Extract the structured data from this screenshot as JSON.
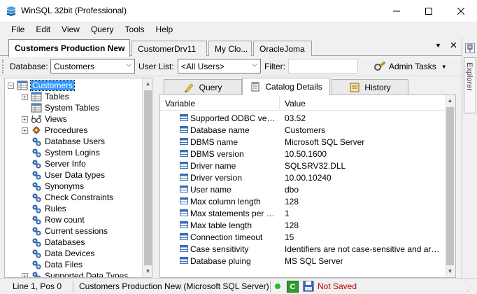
{
  "window": {
    "title": "WinSQL 32bit (Professional)",
    "minimize_icon": "minimize-icon",
    "maximize_icon": "maximize-icon",
    "close_icon": "close-icon"
  },
  "menu": [
    "File",
    "Edit",
    "View",
    "Query",
    "Tools",
    "Help"
  ],
  "tabs": [
    {
      "label": "Customers Production New",
      "active": true
    },
    {
      "label": "CustomerDrv11",
      "active": false
    },
    {
      "label": "My Clo...",
      "active": false
    },
    {
      "label": "OracleJoma",
      "active": false
    }
  ],
  "explorer": {
    "label": "Explorer"
  },
  "toolbar": {
    "database_label": "Database:",
    "database_value": "Customers",
    "user_list_label": "User List:",
    "user_list_value": "<All Users>",
    "filter_label": "Filter:",
    "filter_value": "",
    "admin_tasks_label": "Admin Tasks"
  },
  "tree": {
    "root": "Customers",
    "items": [
      {
        "label": "Tables",
        "expandable": true,
        "icon": "table-icon"
      },
      {
        "label": "System Tables",
        "expandable": false,
        "icon": "table-icon"
      },
      {
        "label": "Views",
        "expandable": true,
        "icon": "glasses-icon"
      },
      {
        "label": "Procedures",
        "expandable": true,
        "icon": "procedure-icon"
      },
      {
        "label": "Database Users",
        "expandable": false,
        "icon": "gear-icon"
      },
      {
        "label": "System Logins",
        "expandable": false,
        "icon": "gear-icon"
      },
      {
        "label": "Server Info",
        "expandable": false,
        "icon": "gear-icon"
      },
      {
        "label": "User Data types",
        "expandable": false,
        "icon": "gear-icon"
      },
      {
        "label": "Synonyms",
        "expandable": false,
        "icon": "gear-icon"
      },
      {
        "label": "Check Constraints",
        "expandable": false,
        "icon": "gear-icon"
      },
      {
        "label": "Rules",
        "expandable": false,
        "icon": "gear-icon"
      },
      {
        "label": "Row count",
        "expandable": false,
        "icon": "gear-icon"
      },
      {
        "label": "Current sessions",
        "expandable": false,
        "icon": "gear-icon"
      },
      {
        "label": "Databases",
        "expandable": false,
        "icon": "gear-icon"
      },
      {
        "label": "Data Devices",
        "expandable": false,
        "icon": "gear-icon"
      },
      {
        "label": "Data Files",
        "expandable": false,
        "icon": "gear-icon"
      },
      {
        "label": "Supported Data Types",
        "expandable": true,
        "icon": "gear-icon"
      }
    ]
  },
  "subtabs": [
    {
      "label": "Query",
      "icon": "query-icon",
      "active": false
    },
    {
      "label": "Catalog Details",
      "icon": "catalog-icon",
      "active": true
    },
    {
      "label": "History",
      "icon": "history-icon",
      "active": false
    }
  ],
  "grid": {
    "headers": [
      "Variable",
      "Value"
    ],
    "rows": [
      {
        "variable": "Supported ODBC version",
        "value": "03.52"
      },
      {
        "variable": "Database name",
        "value": "Customers"
      },
      {
        "variable": "DBMS name",
        "value": "Microsoft SQL Server"
      },
      {
        "variable": "DBMS version",
        "value": "10.50.1600"
      },
      {
        "variable": "Driver name",
        "value": "SQLSRV32.DLL"
      },
      {
        "variable": "Driver version",
        "value": "10.00.10240"
      },
      {
        "variable": "User name",
        "value": "dbo"
      },
      {
        "variable": "Max column length",
        "value": "128"
      },
      {
        "variable": "Max statements per con...",
        "value": "1"
      },
      {
        "variable": "Max table length",
        "value": "128"
      },
      {
        "variable": "Connection timeout",
        "value": "15"
      },
      {
        "variable": "Case sensitivity",
        "value": "Identifiers are not case-sensitive and are stored i..."
      },
      {
        "variable": "Database pluing",
        "value": "MS SQL Server"
      }
    ]
  },
  "status": {
    "position": "Line 1, Pos 0",
    "connection": "Customers Production New (Microsoft SQL Server)",
    "save_state": "Not Saved",
    "save_color": "#c00000"
  },
  "colors": {
    "selection": "#3399ff",
    "accent": "#1e88e5"
  }
}
